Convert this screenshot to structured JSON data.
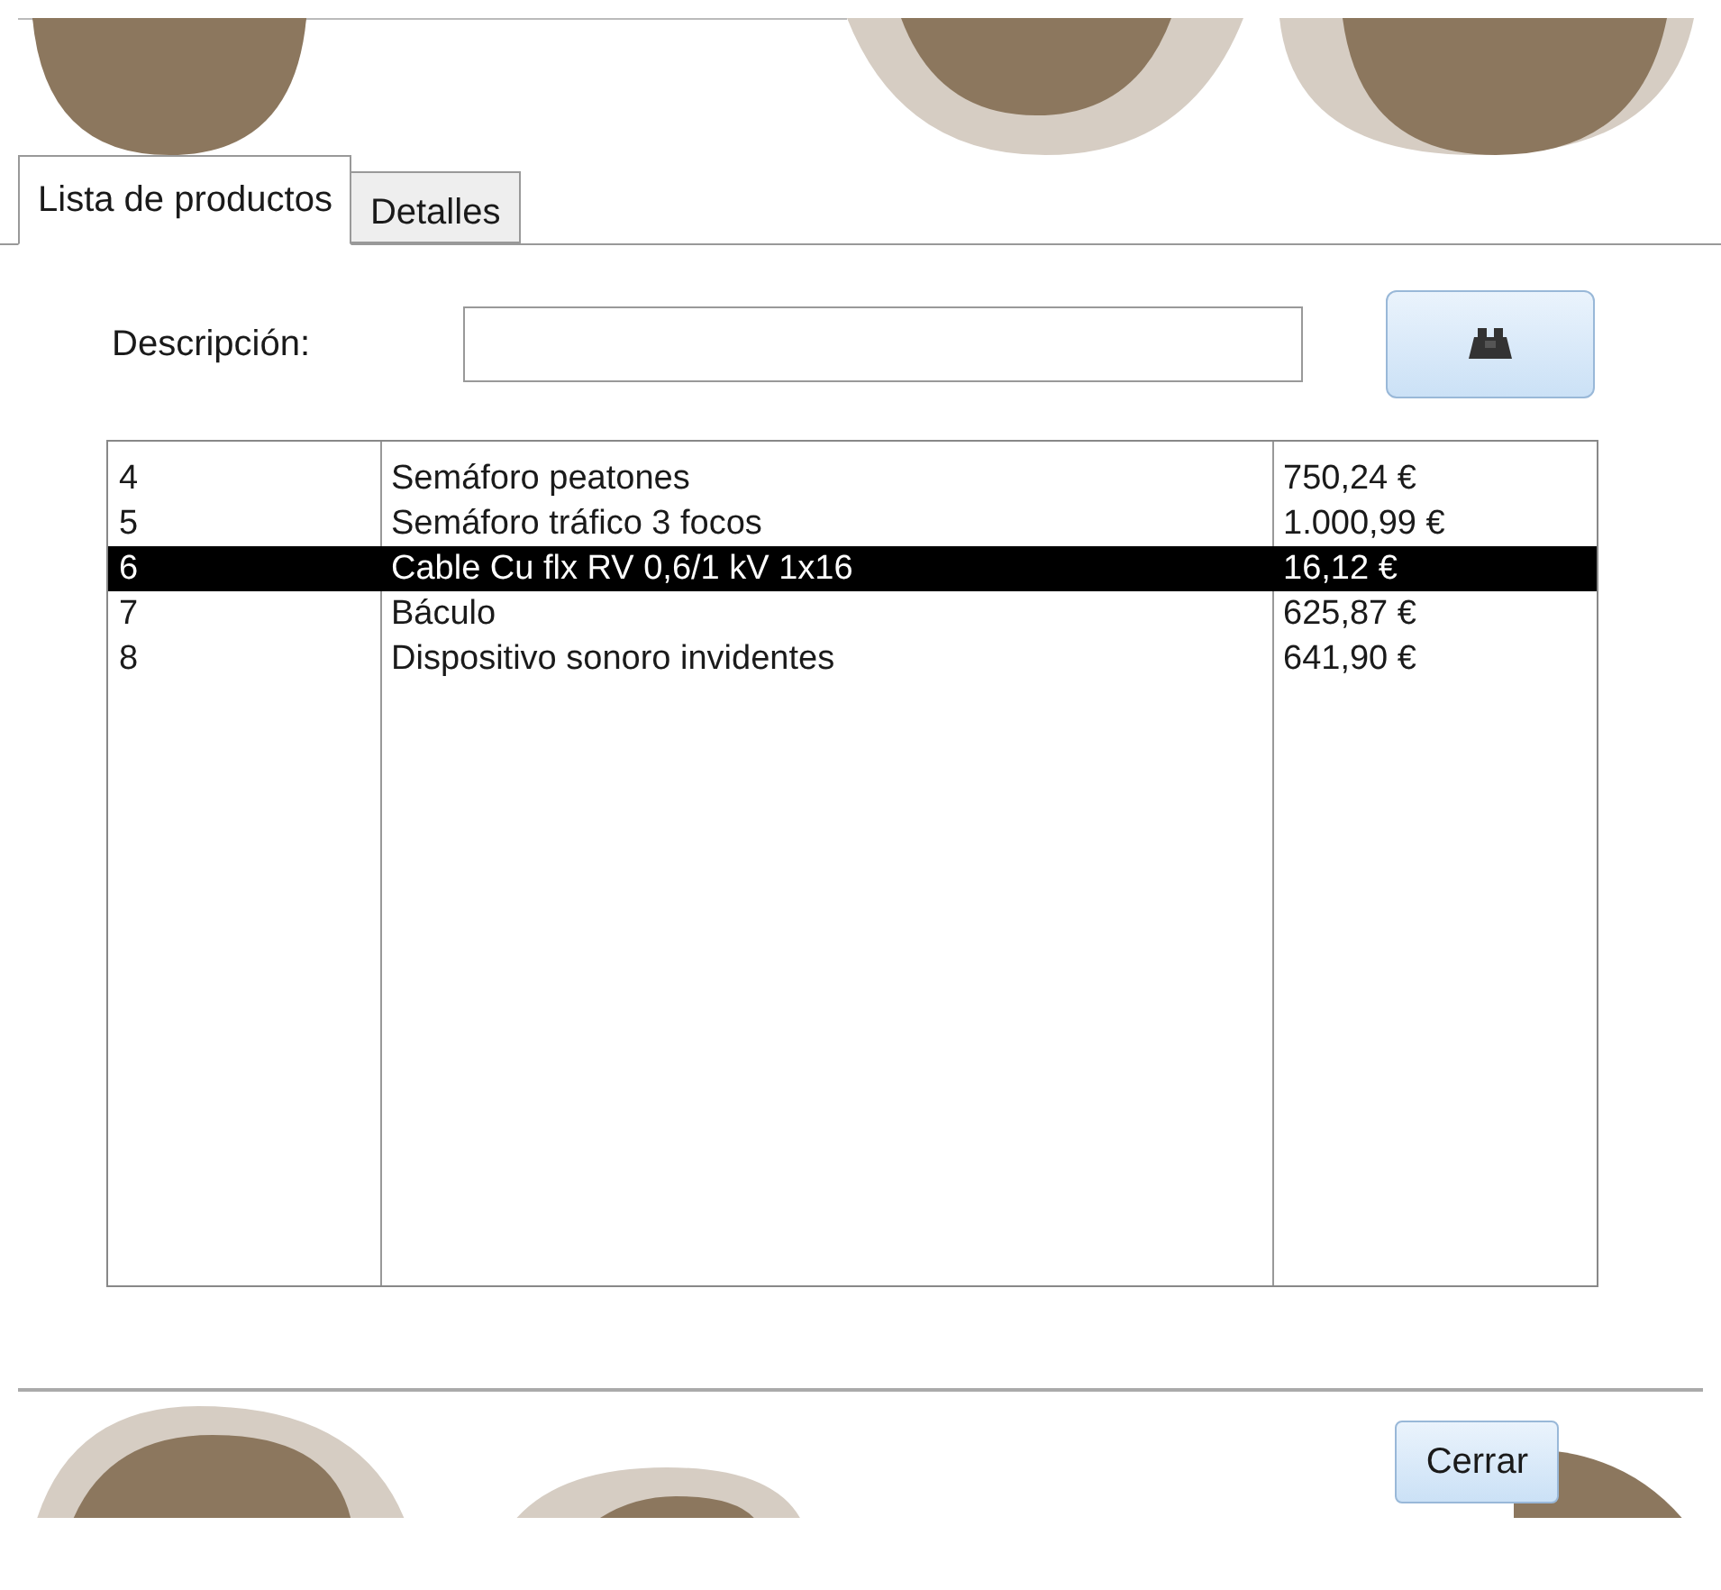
{
  "tabs": [
    {
      "label": "Lista de productos",
      "selected": true
    },
    {
      "label": "Detalles",
      "selected": false
    }
  ],
  "search": {
    "label": "Descripción:"
  },
  "table": {
    "rows": [
      {
        "cells": [
          "4",
          "Semáforo peatones",
          "750,24 €"
        ],
        "selected": false
      },
      {
        "cells": [
          "5",
          "Semáforo tráfico 3 focos",
          "1.000,99 €"
        ],
        "selected": false
      },
      {
        "cells": [
          "6",
          "Cable Cu flx RV 0,6/1 kV 1x16",
          "16,12 €"
        ],
        "selected": true
      },
      {
        "cells": [
          "7",
          "Báculo",
          "625,87 €"
        ],
        "selected": false
      },
      {
        "cells": [
          "8",
          "Dispositivo sonoro invidentes",
          "641,90 €"
        ],
        "selected": false
      }
    ]
  },
  "buttons": [
    {
      "label": "Cerrar"
    }
  ]
}
